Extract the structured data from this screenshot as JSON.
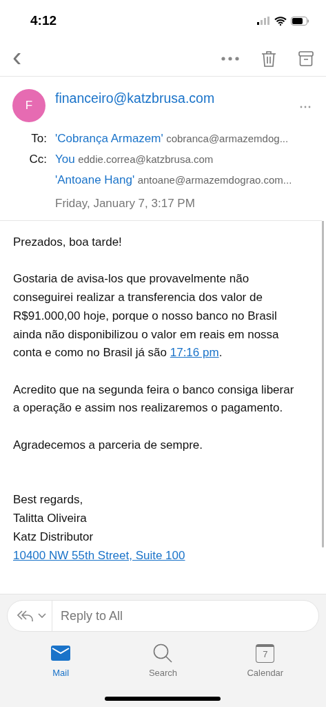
{
  "status_bar": {
    "time": "4:12"
  },
  "toolbar": {
    "back": "‹"
  },
  "message": {
    "avatar_letter": "F",
    "sender": "financeiro@katzbrusa.com",
    "recipients": [
      {
        "label": "To:",
        "name": "'Cobrança Armazem'",
        "address": "cobranca@armazemdog..."
      },
      {
        "label": "Cc:",
        "name": "You",
        "address": "eddie.correa@katzbrusa.com"
      },
      {
        "name": "'Antoane Hang'",
        "address": "antoane@armazemdograo.com..."
      }
    ],
    "date": "Friday, January 7, 3:17 PM",
    "body": [
      {
        "kind": "paragraph",
        "parts": [
          {
            "text": "Prezados, boa tarde!"
          }
        ]
      },
      {
        "kind": "paragraph",
        "parts": [
          {
            "text": "Gostaria de avisa-los que provavelmente não conseguirei realizar a transferencia dos valor de R$91.000,00 hoje, porque o nosso banco no Brasil ainda não disponibilizou o valor em reais em nossa conta e como no Brasil já são "
          },
          {
            "text": "17:16 pm",
            "link": true
          },
          {
            "text": "."
          }
        ]
      },
      {
        "kind": "paragraph",
        "parts": [
          {
            "text": "Acredito que na segunda feira o banco consiga liberar a operação e assim nos realizaremos o pagamento."
          }
        ]
      },
      {
        "kind": "paragraph",
        "parts": [
          {
            "text": "Agradecemos a parceria de sempre."
          }
        ]
      },
      {
        "kind": "signature",
        "lines": [
          {
            "text": "Best regards,"
          },
          {
            "text": "Talitta Oliveira"
          },
          {
            "text": "Katz Distributor"
          },
          {
            "text": "10400 NW 55th Street, Suite 100",
            "link": true
          }
        ]
      }
    ]
  },
  "reply": {
    "placeholder": "Reply to All"
  },
  "tabs": [
    {
      "label": "Mail",
      "selected": true
    },
    {
      "label": "Search",
      "selected": false
    },
    {
      "label": "Calendar",
      "selected": false,
      "day": "7"
    }
  ]
}
